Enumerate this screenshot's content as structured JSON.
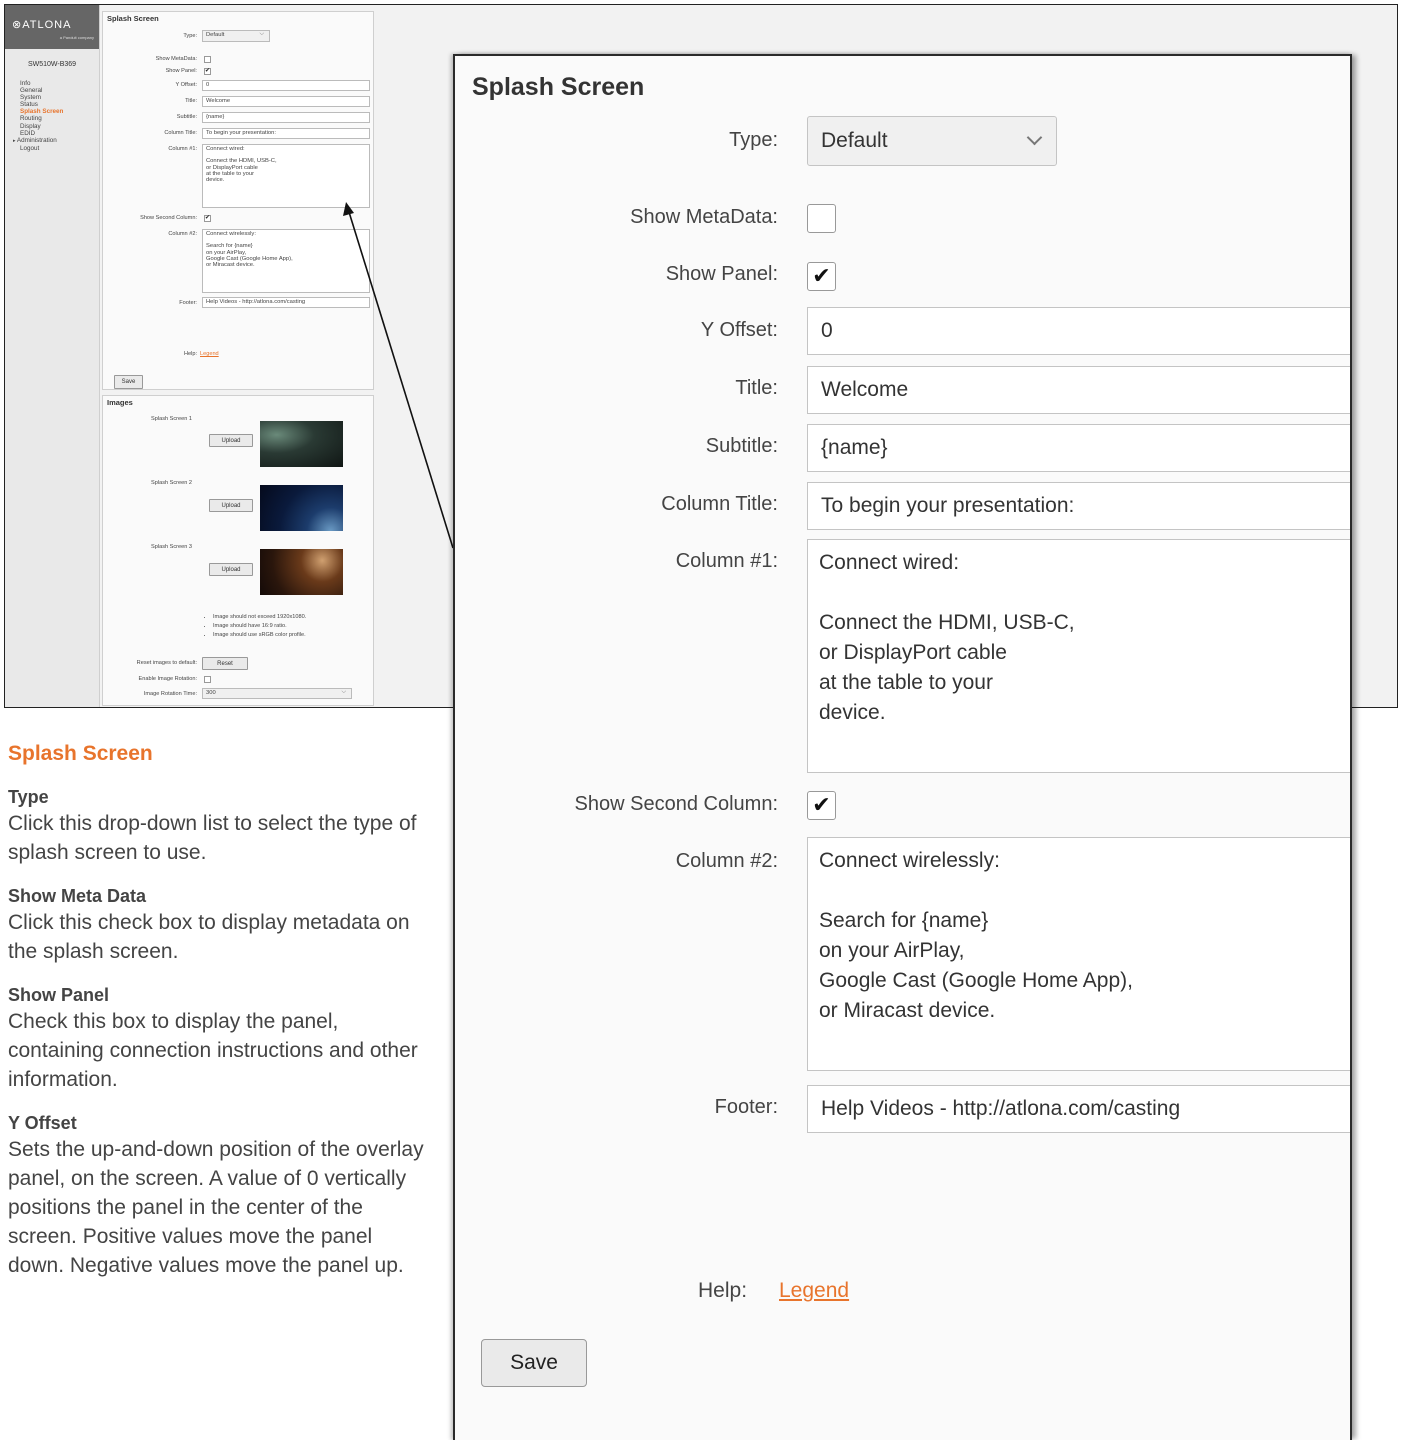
{
  "small": {
    "logo": "⊗ATLONA",
    "logo_tagline": "a Panduit company",
    "device": "SW510W-B369",
    "nav": [
      "Info",
      "General",
      "System",
      "Status",
      "Splash Screen",
      "Routing",
      "Display",
      "EDID",
      "Administration",
      "Logout"
    ],
    "splash": {
      "title": "Splash Screen",
      "type_label": "Type:",
      "type_value": "Default",
      "show_metadata_label": "Show MetaData:",
      "show_panel_label": "Show Panel:",
      "y_offset_label": "Y Offset:",
      "y_offset_value": "0",
      "title_label": "Title:",
      "title_value": "Welcome",
      "subtitle_label": "Subtitle:",
      "subtitle_value": "{name}",
      "column_title_label": "Column Title:",
      "column_title_value": "To begin your presentation:",
      "column1_label": "Column #1:",
      "column1_value": "Connect wired:\n\nConnect the HDMI, USB-C,\nor DisplayPort cable\nat the table to your\ndevice.",
      "show_second_label": "Show Second Column:",
      "column2_label": "Column #2:",
      "column2_value": "Connect wirelessly:\n\nSearch for {name}\non your AirPlay,\nGoogle Cast (Google Home App),\nor Miracast device.",
      "footer_label": "Footer:",
      "footer_value": "Help Videos - http://atlona.com/casting",
      "help_label": "Help:",
      "help_link": "Legend",
      "save": "Save"
    },
    "images": {
      "title": "Images",
      "screen1": "Splash Screen 1",
      "screen2": "Splash Screen 2",
      "screen3": "Splash Screen 3",
      "upload": "Upload",
      "notes": [
        "Image should not exceed 1920x1080.",
        "Image should have 16:9 ratio.",
        "Image should use sRGB color profile."
      ],
      "reset_label": "Reset images to default:",
      "reset_btn": "Reset",
      "rotation_label": "Enable Image Rotation:",
      "rotation_time_label": "Image Rotation Time:",
      "rotation_time_value": "300"
    }
  },
  "zoom": {
    "title": "Splash Screen",
    "type_label": "Type:",
    "type_value": "Default",
    "show_metadata_label": "Show MetaData:",
    "show_panel_label": "Show Panel:",
    "show_panel_check": "✔",
    "y_offset_label": "Y Offset:",
    "y_offset_value": "0",
    "title_label": "Title:",
    "title_value": "Welcome",
    "subtitle_label": "Subtitle:",
    "subtitle_value": "{name}",
    "column_title_label": "Column Title:",
    "column_title_value": "To begin your presentation:",
    "column1_label": "Column #1:",
    "column1_value": "Connect wired:\n\nConnect the HDMI, USB-C,\nor DisplayPort cable\nat the table to your\ndevice.",
    "show_second_label": "Show Second Column:",
    "show_second_check": "✔",
    "column2_label": "Column #2:",
    "column2_value": "Connect wirelessly:\n\nSearch for {name}\non your AirPlay,\nGoogle Cast (Google Home App),\nor Miracast device.",
    "footer_label": "Footer:",
    "footer_value": "Help Videos - http://atlona.com/casting",
    "help_label": "Help:",
    "help_link": "Legend",
    "save": "Save"
  },
  "doc": {
    "heading": "Splash Screen",
    "sections": [
      {
        "title": "Type",
        "body": "Click this drop-down list to select the type of splash screen to use."
      },
      {
        "title": "Show Meta Data",
        "body": "Click this check box to display metadata on the splash screen."
      },
      {
        "title": "Show Panel",
        "body": "Check this box to display the panel, containing connection instructions and other information."
      },
      {
        "title": "Y Offset",
        "body": "Sets the up-and-down position of the overlay panel, on the screen. A value of 0 vertically positions the panel in the center of the screen.  Positive values move the panel down. Negative values move the panel up."
      }
    ]
  },
  "colors": {
    "accent": "#e8742c",
    "sidebar_logo_bg": "#666666"
  }
}
